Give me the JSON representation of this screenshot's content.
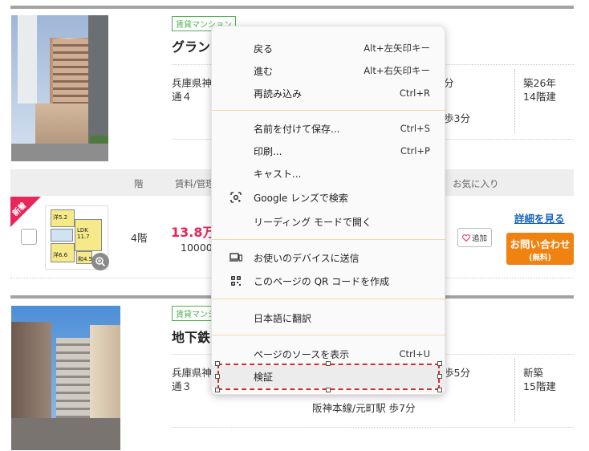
{
  "listing1": {
    "tag": "賃貸マンション",
    "title": "グラン",
    "address_line1": "兵庫県神",
    "address_line2": "通４",
    "station_partial": "分",
    "walk_partial": "歩3分",
    "age": "築26年",
    "floors": "14階建"
  },
  "table_header": {
    "floor": "階",
    "rent": "賃料/管理",
    "favorite": "お気に入り"
  },
  "room": {
    "new_badge": "新着",
    "floor": "4階",
    "price": "13.8万",
    "fee": "10000",
    "add_label": "追加",
    "detail_link": "詳細を見る",
    "inquiry_line1": "お問い合わせ",
    "inquiry_line2": "(無料)",
    "plan_labels": [
      "洋5.2",
      "LDK 11.7",
      "洋6.6",
      "和4.5"
    ]
  },
  "listing2": {
    "tag": "賃貸マンシ",
    "title": "地下鉄",
    "address_line1": "兵庫県神",
    "address_line2": "通３",
    "station_partial": "歩5分",
    "station_line": "阪神本線/元町駅 歩7分",
    "age": "新築",
    "floors": "15階建"
  },
  "context_menu": {
    "items": [
      {
        "label": "戻る",
        "shortcut": "Alt+左矢印キー",
        "icon": ""
      },
      {
        "label": "進む",
        "shortcut": "Alt+右矢印キー",
        "icon": ""
      },
      {
        "label": "再読み込み",
        "shortcut": "Ctrl+R",
        "icon": ""
      },
      {
        "label": "名前を付けて保存...",
        "shortcut": "Ctrl+S",
        "icon": ""
      },
      {
        "label": "印刷...",
        "shortcut": "Ctrl+P",
        "icon": ""
      },
      {
        "label": "キャスト...",
        "shortcut": "",
        "icon": ""
      },
      {
        "label": "Google レンズで検索",
        "shortcut": "",
        "icon": "lens-icon"
      },
      {
        "label": "リーディング モードで開く",
        "shortcut": "",
        "icon": ""
      },
      {
        "label": "お使いのデバイスに送信",
        "shortcut": "",
        "icon": "devices-icon"
      },
      {
        "label": "このページの QR コードを作成",
        "shortcut": "",
        "icon": "qr-code-icon"
      },
      {
        "label": "日本語に翻訳",
        "shortcut": "",
        "icon": ""
      },
      {
        "label": "ページのソースを表示",
        "shortcut": "Ctrl+U",
        "icon": ""
      },
      {
        "label": "検証",
        "shortcut": "",
        "icon": ""
      }
    ]
  },
  "colors": {
    "accent_pink": "#e8265a",
    "orange": "#f0820f",
    "link_blue": "#1565c0",
    "tag_green": "#4caf50",
    "selection_red": "#d32f2f"
  }
}
